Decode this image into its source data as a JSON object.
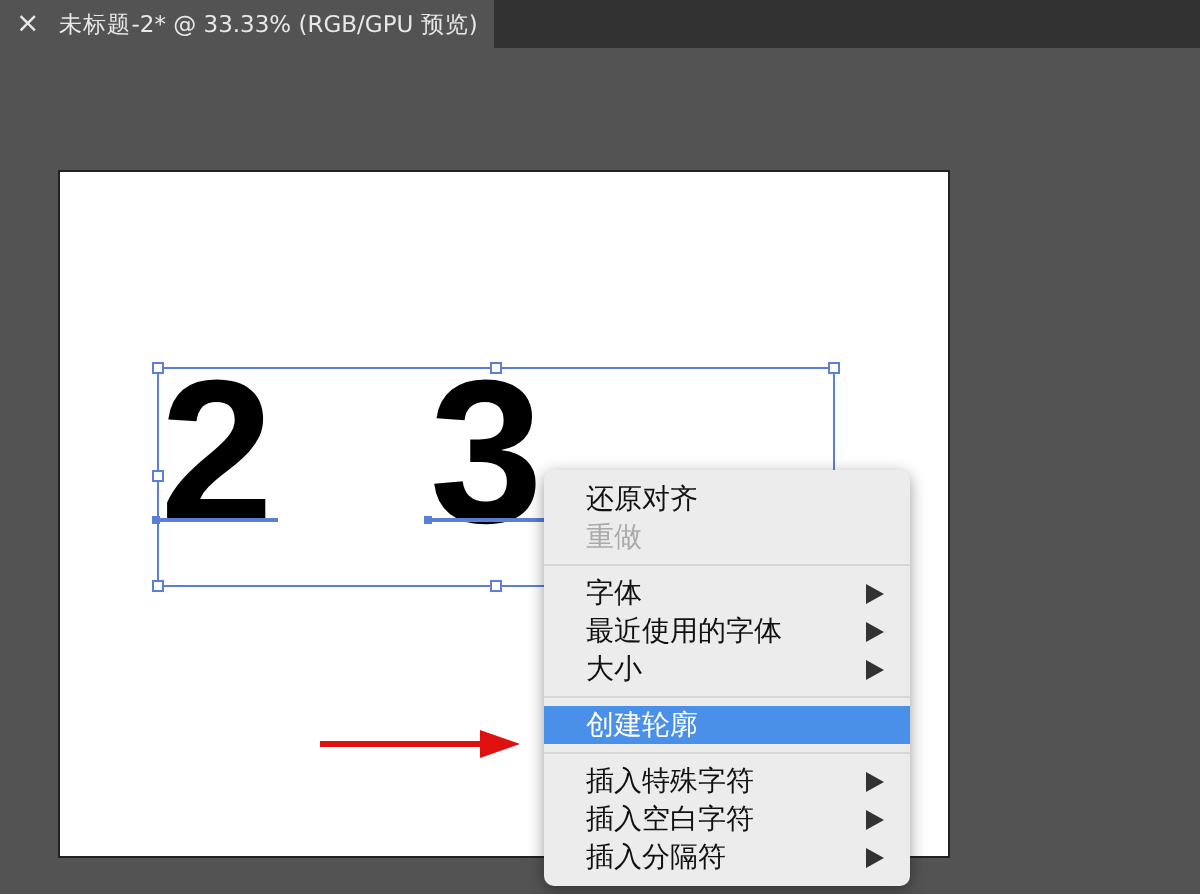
{
  "tab": {
    "close": "×",
    "title": "未标题-2* @ 33.33% (RGB/GPU 预览)",
    "selected": true
  },
  "artboard": {
    "glyphs": [
      "2",
      "3"
    ]
  },
  "context_menu": {
    "items": [
      {
        "kind": "item",
        "label": "还原对齐",
        "disabled": false,
        "selected": false,
        "submenu": false
      },
      {
        "kind": "item",
        "label": "重做",
        "disabled": true,
        "selected": false,
        "submenu": false
      },
      {
        "kind": "separator"
      },
      {
        "kind": "item",
        "label": "字体",
        "disabled": false,
        "selected": false,
        "submenu": true
      },
      {
        "kind": "item",
        "label": "最近使用的字体",
        "disabled": false,
        "selected": false,
        "submenu": true
      },
      {
        "kind": "item",
        "label": "大小",
        "disabled": false,
        "selected": false,
        "submenu": true
      },
      {
        "kind": "separator"
      },
      {
        "kind": "item",
        "label": "创建轮廓",
        "disabled": false,
        "selected": true,
        "submenu": false
      },
      {
        "kind": "separator"
      },
      {
        "kind": "item",
        "label": "插入特殊字符",
        "disabled": false,
        "selected": false,
        "submenu": true
      },
      {
        "kind": "item",
        "label": "插入空白字符",
        "disabled": false,
        "selected": false,
        "submenu": true
      },
      {
        "kind": "item",
        "label": "插入分隔符",
        "disabled": false,
        "selected": false,
        "submenu": true
      }
    ]
  }
}
